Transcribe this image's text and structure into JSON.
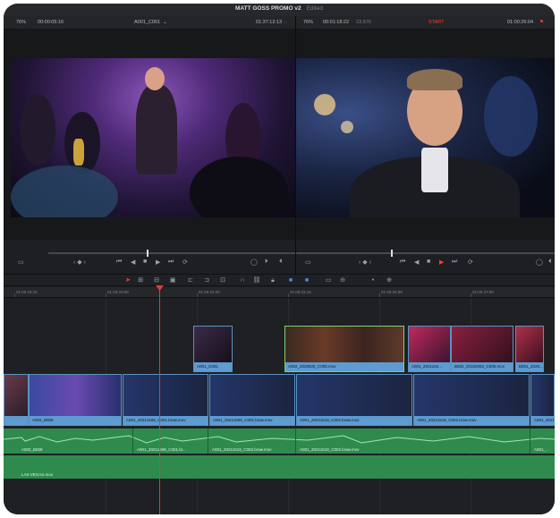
{
  "window": {
    "title": "MATT GOSS PROMO v2",
    "edited": "Edited"
  },
  "source_viewer": {
    "zoom": "76%",
    "timecode_in": "00:00:05:16",
    "clip_name": "A001_C001",
    "timecode_out": "01:37:12:13",
    "more": "···"
  },
  "timeline_viewer": {
    "zoom": "76%",
    "timecode_in": "00:01:18:22",
    "speed": "23.976",
    "start_label": "START",
    "timecode_out": "01:00:26:04"
  },
  "ruler_timecodes": [
    "01:00:18:16",
    "01:00:20:08",
    "01:00:22:00",
    "01:00:23:16",
    "01:00:25:08",
    "01:00:27:00",
    "01:00:28:16"
  ],
  "video_track_2": [
    {
      "name": "A001_C001"
    },
    {
      "name": "A002_2028525_C005.mov"
    },
    {
      "name": "A001_2021164..."
    },
    {
      "name": "B002_20182052_C005.mov"
    },
    {
      "name": "B001_2026..."
    }
  ],
  "video_track_1": [
    {
      "name": "A002_B008"
    },
    {
      "name": "A001_20211508_C001.braw.mov"
    },
    {
      "name": "A001_20211508_C001.braw.mov"
    },
    {
      "name": "A001_20211519_C002.braw.mov"
    },
    {
      "name": "A001_20211519_C002.braw.mov"
    },
    {
      "name": "A001_2021..."
    }
  ],
  "audio_track_1": [
    {
      "name": "A002_B008"
    },
    {
      "name": "A001_20211508_C001.br..."
    },
    {
      "name": "A001_20211519_C002.braw.mov"
    },
    {
      "name": "A001_20211519_C002.braw.mov"
    },
    {
      "name": "A001_..."
    }
  ],
  "audio_track_2": [
    {
      "name": "LAS VEGAS.mov"
    }
  ],
  "colors": {
    "video_clip": "#5d9bd1",
    "audio_clip": "#2e8b4d",
    "playhead": "#e53b30",
    "accent_red": "#ff3b30"
  }
}
